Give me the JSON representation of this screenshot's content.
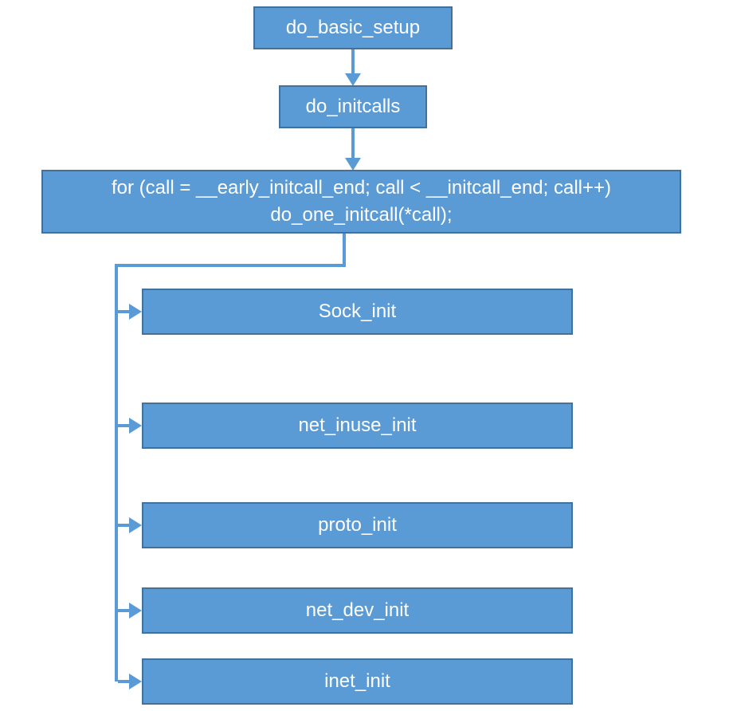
{
  "nodes": {
    "do_basic_setup": "do_basic_setup",
    "do_initcalls": "do_initcalls",
    "for_loop_line1": "for (call = __early_initcall_end; call < __initcall_end; call++)",
    "for_loop_line2": "do_one_initcall(*call);",
    "sock_init": "Sock_init",
    "net_inuse_init": "net_inuse_init",
    "proto_init": "proto_init",
    "net_dev_init": "net_dev_init",
    "inet_init": "inet_init"
  },
  "colors": {
    "box_fill": "#5b9bd5",
    "box_border": "#41719c",
    "arrow": "#5b9bd5",
    "text": "#ffffff"
  }
}
